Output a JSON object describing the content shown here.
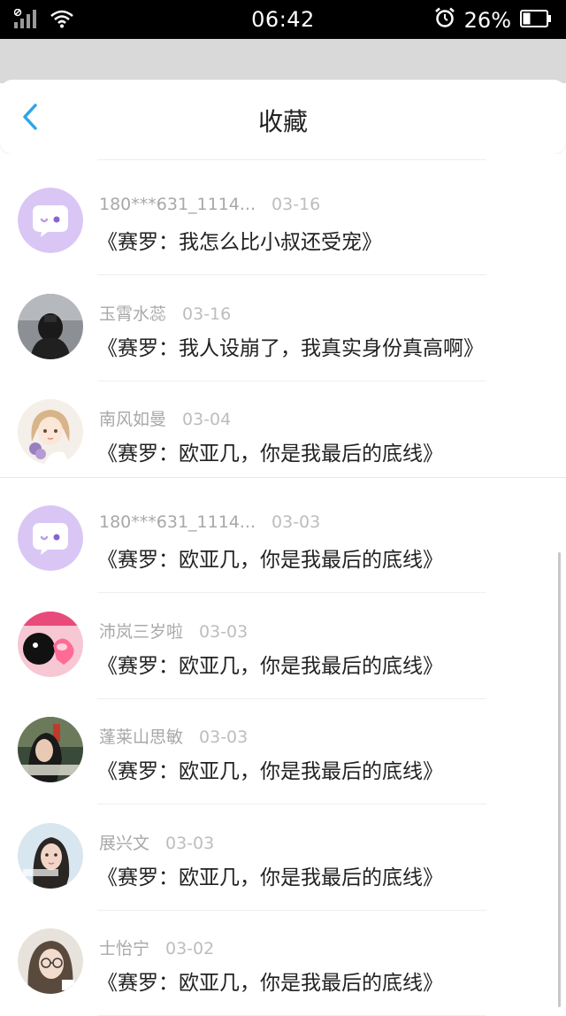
{
  "status_bar": {
    "time": "06:42",
    "battery": "26%"
  },
  "header": {
    "title": "收藏"
  },
  "favorites": [
    {
      "user": "180***631_1114...",
      "date": "03-16",
      "title": "《赛罗：我怎么比小叔还受宠》",
      "avatar": "default-chat"
    },
    {
      "user": "玉霄水蕊",
      "date": "03-16",
      "title": "《赛罗：我人设崩了，我真实身份真高啊》",
      "avatar": "photo-dark"
    },
    {
      "user": "南风如曼",
      "date": "03-04",
      "title": "《赛罗：欧亚几，你是我最后的底线》",
      "avatar": "anime-girl"
    },
    {
      "user": "180***631_1114...",
      "date": "03-03",
      "title": "《赛罗：欧亚几，你是我最后的底线》",
      "avatar": "default-chat"
    },
    {
      "user": "沛岚三岁啦",
      "date": "03-03",
      "title": "《赛罗：欧亚几，你是我最后的底线》",
      "avatar": "pink-heart"
    },
    {
      "user": "蓬莱山思敏",
      "date": "03-03",
      "title": "《赛罗：欧亚几，你是我最后的底线》",
      "avatar": "photo-girl"
    },
    {
      "user": "展兴文",
      "date": "03-03",
      "title": "《赛罗：欧亚几，你是我最后的底线》",
      "avatar": "photo-girl-2"
    },
    {
      "user": "士怡宁",
      "date": "03-02",
      "title": "《赛罗：欧亚几，你是我最后的底线》",
      "avatar": "photo-glasses"
    }
  ],
  "colors": {
    "accent": "#2fa5e8",
    "default_avatar": "#d9c6f5",
    "username": "#a8a8a8",
    "title_text": "#222222"
  }
}
